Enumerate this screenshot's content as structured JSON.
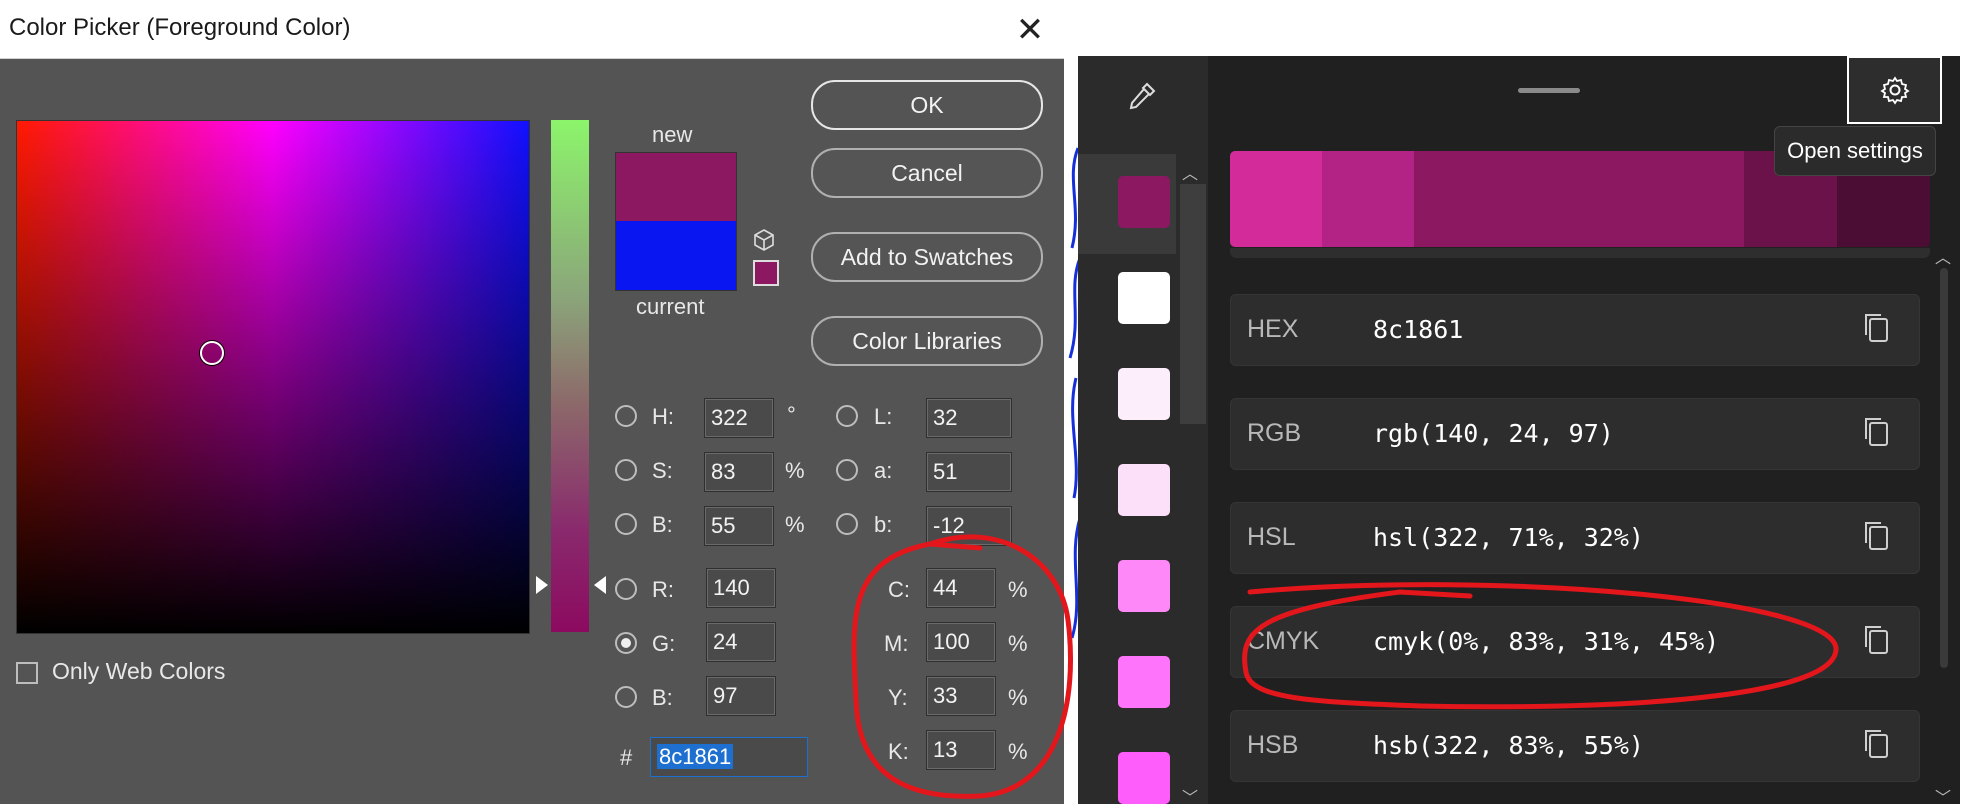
{
  "color_picker": {
    "title": "Color Picker (Foreground Color)",
    "close_glyph": "✕",
    "new_label": "new",
    "current_label": "current",
    "new_color": "#8c1861",
    "current_color": "#0a16f2",
    "buttons": {
      "ok": "OK",
      "cancel": "Cancel",
      "add_to_swatches": "Add to Swatches",
      "color_libraries": "Color Libraries"
    },
    "hsb": {
      "h_label": "H:",
      "h_value": "322",
      "h_unit": "°",
      "s_label": "S:",
      "s_value": "83",
      "s_unit": "%",
      "b_label": "B:",
      "b_value": "55",
      "b_unit": "%"
    },
    "rgb": {
      "r_label": "R:",
      "r_value": "140",
      "g_label": "G:",
      "g_value": "24",
      "b_label": "B:",
      "b_value": "97"
    },
    "lab": {
      "l_label": "L:",
      "l_value": "32",
      "a_label": "a:",
      "a_value": "51",
      "b_label": "b:",
      "b_value": "-12"
    },
    "cmyk": {
      "c_label": "C:",
      "c_value": "44",
      "c_unit": "%",
      "m_label": "M:",
      "m_value": "100",
      "m_unit": "%",
      "y_label": "Y:",
      "y_value": "33",
      "y_unit": "%",
      "k_label": "K:",
      "k_value": "13",
      "k_unit": "%"
    },
    "selected_channel": "G",
    "only_web_colors": "Only Web Colors",
    "hash_label": "#",
    "hex_value": "8c1861"
  },
  "powertoys": {
    "tooltip": "Open settings",
    "history_colors": [
      "#8c1861",
      "#ffffff",
      "#fdeefb",
      "#fce0fa",
      "#fe88f8",
      "#fe74fb",
      "#fe5cfb"
    ],
    "shades": [
      "#d42b9b",
      "#b32285",
      "#8c1861",
      "#6a1249",
      "#4c0d35"
    ],
    "formats": [
      {
        "label": "HEX",
        "value": "8c1861"
      },
      {
        "label": "RGB",
        "value": "rgb(140, 24, 97)"
      },
      {
        "label": "HSL",
        "value": "hsl(322, 71%, 32%)"
      },
      {
        "label": "CMYK",
        "value": "cmyk(0%, 83%, 31%, 45%)"
      },
      {
        "label": "HSB",
        "value": "hsb(322, 83%, 55%)"
      }
    ],
    "icons": [
      "pipette-icon",
      "gear-icon",
      "close-icon",
      "copy-icon"
    ]
  },
  "colors": {
    "annotation_red": "#e3161c",
    "dialog_bg": "#545454",
    "powertoys_bg": "#202020"
  }
}
